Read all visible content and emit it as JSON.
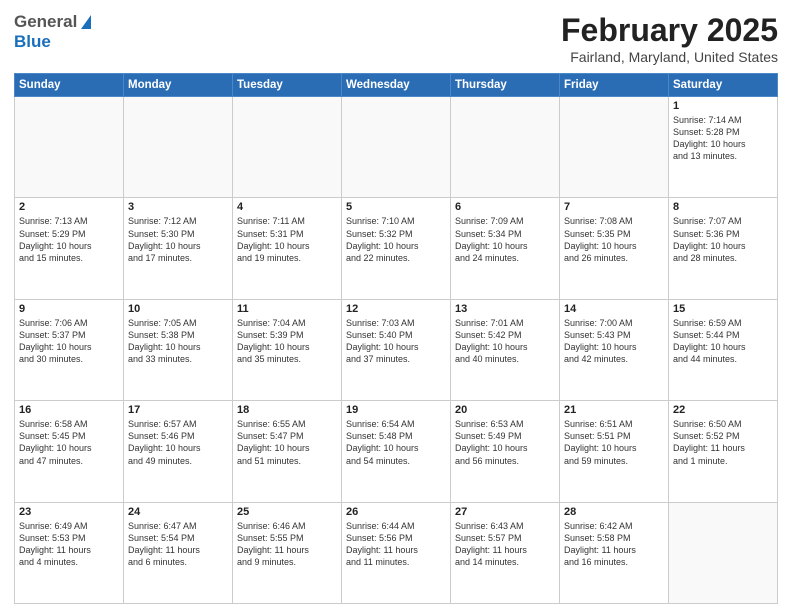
{
  "header": {
    "logo_general": "General",
    "logo_blue": "Blue",
    "title": "February 2025",
    "subtitle": "Fairland, Maryland, United States"
  },
  "days_of_week": [
    "Sunday",
    "Monday",
    "Tuesday",
    "Wednesday",
    "Thursday",
    "Friday",
    "Saturday"
  ],
  "weeks": [
    {
      "days": [
        {
          "num": "",
          "text": ""
        },
        {
          "num": "",
          "text": ""
        },
        {
          "num": "",
          "text": ""
        },
        {
          "num": "",
          "text": ""
        },
        {
          "num": "",
          "text": ""
        },
        {
          "num": "",
          "text": ""
        },
        {
          "num": "1",
          "text": "Sunrise: 7:14 AM\nSunset: 5:28 PM\nDaylight: 10 hours\nand 13 minutes."
        }
      ]
    },
    {
      "days": [
        {
          "num": "2",
          "text": "Sunrise: 7:13 AM\nSunset: 5:29 PM\nDaylight: 10 hours\nand 15 minutes."
        },
        {
          "num": "3",
          "text": "Sunrise: 7:12 AM\nSunset: 5:30 PM\nDaylight: 10 hours\nand 17 minutes."
        },
        {
          "num": "4",
          "text": "Sunrise: 7:11 AM\nSunset: 5:31 PM\nDaylight: 10 hours\nand 19 minutes."
        },
        {
          "num": "5",
          "text": "Sunrise: 7:10 AM\nSunset: 5:32 PM\nDaylight: 10 hours\nand 22 minutes."
        },
        {
          "num": "6",
          "text": "Sunrise: 7:09 AM\nSunset: 5:34 PM\nDaylight: 10 hours\nand 24 minutes."
        },
        {
          "num": "7",
          "text": "Sunrise: 7:08 AM\nSunset: 5:35 PM\nDaylight: 10 hours\nand 26 minutes."
        },
        {
          "num": "8",
          "text": "Sunrise: 7:07 AM\nSunset: 5:36 PM\nDaylight: 10 hours\nand 28 minutes."
        }
      ]
    },
    {
      "days": [
        {
          "num": "9",
          "text": "Sunrise: 7:06 AM\nSunset: 5:37 PM\nDaylight: 10 hours\nand 30 minutes."
        },
        {
          "num": "10",
          "text": "Sunrise: 7:05 AM\nSunset: 5:38 PM\nDaylight: 10 hours\nand 33 minutes."
        },
        {
          "num": "11",
          "text": "Sunrise: 7:04 AM\nSunset: 5:39 PM\nDaylight: 10 hours\nand 35 minutes."
        },
        {
          "num": "12",
          "text": "Sunrise: 7:03 AM\nSunset: 5:40 PM\nDaylight: 10 hours\nand 37 minutes."
        },
        {
          "num": "13",
          "text": "Sunrise: 7:01 AM\nSunset: 5:42 PM\nDaylight: 10 hours\nand 40 minutes."
        },
        {
          "num": "14",
          "text": "Sunrise: 7:00 AM\nSunset: 5:43 PM\nDaylight: 10 hours\nand 42 minutes."
        },
        {
          "num": "15",
          "text": "Sunrise: 6:59 AM\nSunset: 5:44 PM\nDaylight: 10 hours\nand 44 minutes."
        }
      ]
    },
    {
      "days": [
        {
          "num": "16",
          "text": "Sunrise: 6:58 AM\nSunset: 5:45 PM\nDaylight: 10 hours\nand 47 minutes."
        },
        {
          "num": "17",
          "text": "Sunrise: 6:57 AM\nSunset: 5:46 PM\nDaylight: 10 hours\nand 49 minutes."
        },
        {
          "num": "18",
          "text": "Sunrise: 6:55 AM\nSunset: 5:47 PM\nDaylight: 10 hours\nand 51 minutes."
        },
        {
          "num": "19",
          "text": "Sunrise: 6:54 AM\nSunset: 5:48 PM\nDaylight: 10 hours\nand 54 minutes."
        },
        {
          "num": "20",
          "text": "Sunrise: 6:53 AM\nSunset: 5:49 PM\nDaylight: 10 hours\nand 56 minutes."
        },
        {
          "num": "21",
          "text": "Sunrise: 6:51 AM\nSunset: 5:51 PM\nDaylight: 10 hours\nand 59 minutes."
        },
        {
          "num": "22",
          "text": "Sunrise: 6:50 AM\nSunset: 5:52 PM\nDaylight: 11 hours\nand 1 minute."
        }
      ]
    },
    {
      "days": [
        {
          "num": "23",
          "text": "Sunrise: 6:49 AM\nSunset: 5:53 PM\nDaylight: 11 hours\nand 4 minutes."
        },
        {
          "num": "24",
          "text": "Sunrise: 6:47 AM\nSunset: 5:54 PM\nDaylight: 11 hours\nand 6 minutes."
        },
        {
          "num": "25",
          "text": "Sunrise: 6:46 AM\nSunset: 5:55 PM\nDaylight: 11 hours\nand 9 minutes."
        },
        {
          "num": "26",
          "text": "Sunrise: 6:44 AM\nSunset: 5:56 PM\nDaylight: 11 hours\nand 11 minutes."
        },
        {
          "num": "27",
          "text": "Sunrise: 6:43 AM\nSunset: 5:57 PM\nDaylight: 11 hours\nand 14 minutes."
        },
        {
          "num": "28",
          "text": "Sunrise: 6:42 AM\nSunset: 5:58 PM\nDaylight: 11 hours\nand 16 minutes."
        },
        {
          "num": "",
          "text": ""
        }
      ]
    }
  ]
}
